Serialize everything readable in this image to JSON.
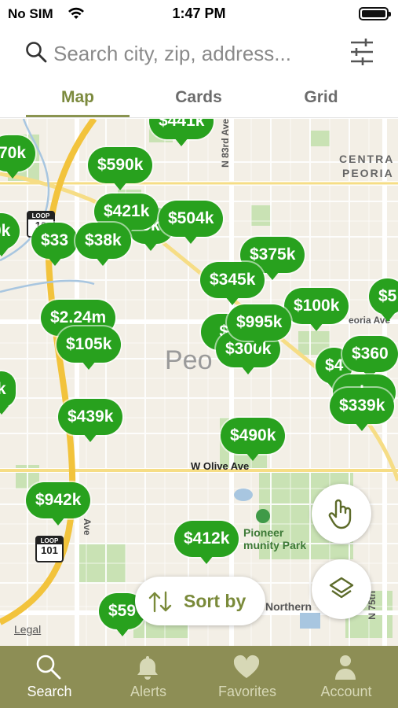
{
  "status_bar": {
    "carrier": "No SIM",
    "time": "1:47 PM"
  },
  "search": {
    "placeholder": "Search city, zip, address..."
  },
  "tabs": [
    {
      "label": "Map",
      "active": true
    },
    {
      "label": "Cards",
      "active": false
    },
    {
      "label": "Grid",
      "active": false
    }
  ],
  "map": {
    "street_labels": {
      "n83rd": "N 83rd Ave",
      "olive": "W Olive Ave",
      "northern": "Northern",
      "n75th": "N 75th",
      "ave_left": "Ave",
      "peoria_ave": "eoria Ave"
    },
    "area_labels": {
      "city": "Peo",
      "centra": "CENTRA",
      "peoria": "PEORIA",
      "park_line1": "Pioneer",
      "park_line2": "munity Park"
    },
    "highway_shields": {
      "loop_top": "LOOP",
      "loop_top_num": "10",
      "loop_bottom": "LOOP",
      "loop_bottom_num": "101"
    },
    "pins": [
      {
        "label": "$441k"
      },
      {
        "label": "70k"
      },
      {
        "label": "$590k"
      },
      {
        "label": "$421k"
      },
      {
        "label": "$504k"
      },
      {
        "label": "0k"
      },
      {
        "label": "$33"
      },
      {
        "label": "$38k"
      },
      {
        "label": "$375k"
      },
      {
        "label": "$345k"
      },
      {
        "label": "$100k"
      },
      {
        "label": "$5"
      },
      {
        "label": "$2.24m"
      },
      {
        "label": "$995k"
      },
      {
        "label": "$105k"
      },
      {
        "label": "$300k"
      },
      {
        "label": "$4"
      },
      {
        "label": "$360"
      },
      {
        "label": "k"
      },
      {
        "label": "$339k"
      },
      {
        "label": "$439k"
      },
      {
        "label": "$490k"
      },
      {
        "label": "$942k"
      },
      {
        "label": "$412k"
      },
      {
        "label": "$59"
      }
    ],
    "legal": "Legal"
  },
  "sort": {
    "label": "Sort by"
  },
  "bottom_nav": [
    {
      "label": "Search",
      "icon": "search-icon",
      "active": true
    },
    {
      "label": "Alerts",
      "icon": "bell-icon",
      "active": false
    },
    {
      "label": "Favorites",
      "icon": "heart-icon",
      "active": false
    },
    {
      "label": "Account",
      "icon": "person-icon",
      "active": false
    }
  ],
  "colors": {
    "pin_green": "#28a11e",
    "accent_olive": "#7c8a3e",
    "nav_background": "#8d8e55"
  }
}
